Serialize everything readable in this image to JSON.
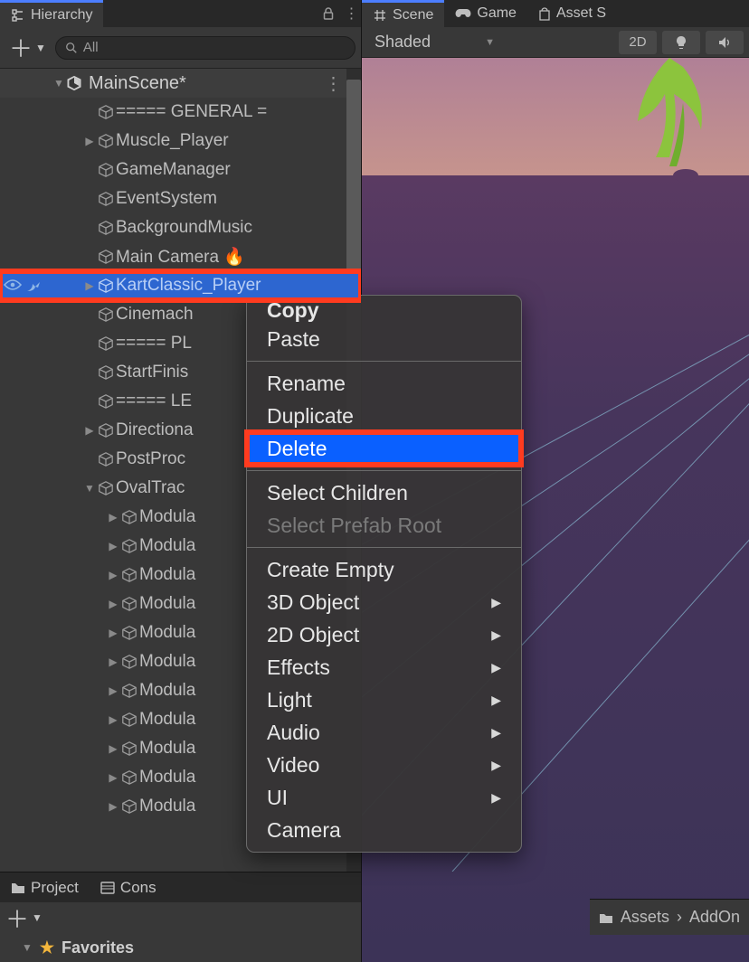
{
  "hierarchy": {
    "tab_label": "Hierarchy",
    "search_text": "All",
    "scene_name": "MainScene*",
    "items": [
      {
        "label": "===== GENERAL =",
        "indent": 2,
        "expand": ""
      },
      {
        "label": "Muscle_Player",
        "indent": 2,
        "expand": "▶"
      },
      {
        "label": "GameManager",
        "indent": 2,
        "expand": ""
      },
      {
        "label": "EventSystem",
        "indent": 2,
        "expand": ""
      },
      {
        "label": "BackgroundMusic",
        "indent": 2,
        "expand": ""
      },
      {
        "label": "Main Camera 🔥",
        "indent": 2,
        "expand": ""
      },
      {
        "label": "KartClassic_Player",
        "indent": 2,
        "expand": "▶",
        "selected": true,
        "highlight_box": true
      },
      {
        "label": "Cinemach",
        "indent": 2,
        "expand": ""
      },
      {
        "label": "===== PL",
        "indent": 2,
        "expand": ""
      },
      {
        "label": "StartFinis",
        "indent": 2,
        "expand": ""
      },
      {
        "label": "===== LE",
        "indent": 2,
        "expand": ""
      },
      {
        "label": "Directiona",
        "indent": 2,
        "expand": "▶"
      },
      {
        "label": "PostProc",
        "indent": 2,
        "expand": ""
      },
      {
        "label": "OvalTrac",
        "indent": 2,
        "expand": "▼"
      },
      {
        "label": "Modula",
        "indent": 3,
        "expand": "▶"
      },
      {
        "label": "Modula",
        "indent": 3,
        "expand": "▶"
      },
      {
        "label": "Modula",
        "indent": 3,
        "expand": "▶"
      },
      {
        "label": "Modula",
        "indent": 3,
        "expand": "▶"
      },
      {
        "label": "Modula",
        "indent": 3,
        "expand": "▶"
      },
      {
        "label": "Modula",
        "indent": 3,
        "expand": "▶"
      },
      {
        "label": "Modula",
        "indent": 3,
        "expand": "▶"
      },
      {
        "label": "Modula",
        "indent": 3,
        "expand": "▶"
      },
      {
        "label": "Modula",
        "indent": 3,
        "expand": "▶"
      },
      {
        "label": "Modula",
        "indent": 3,
        "expand": "▶"
      },
      {
        "label": "Modula",
        "indent": 3,
        "expand": "▶"
      }
    ]
  },
  "bottom_tabs": {
    "project": "Project",
    "console": "Cons"
  },
  "favorites_label": "Favorites",
  "scene_panel": {
    "tabs": [
      {
        "label": "Scene",
        "icon": "grid"
      },
      {
        "label": "Game",
        "icon": "gamepad"
      },
      {
        "label": "Asset S",
        "icon": "bag"
      }
    ],
    "shading": "Shaded",
    "btn_2d": "2D"
  },
  "context_menu": {
    "groups": [
      [
        {
          "label": "Copy",
          "partial_top": true
        },
        {
          "label": "Paste"
        }
      ],
      [
        {
          "label": "Rename"
        },
        {
          "label": "Duplicate"
        },
        {
          "label": "Delete",
          "highlight": true,
          "highlight_box": true
        }
      ],
      [
        {
          "label": "Select Children"
        },
        {
          "label": "Select Prefab Root",
          "disabled": true
        }
      ],
      [
        {
          "label": "Create Empty"
        },
        {
          "label": "3D Object",
          "sub": true
        },
        {
          "label": "2D Object",
          "sub": true
        },
        {
          "label": "Effects",
          "sub": true
        },
        {
          "label": "Light",
          "sub": true
        },
        {
          "label": "Audio",
          "sub": true
        },
        {
          "label": "Video",
          "sub": true
        },
        {
          "label": "UI",
          "sub": true
        },
        {
          "label": "Camera"
        }
      ]
    ]
  },
  "breadcrumb": {
    "root": "Assets",
    "next": "AddOn"
  }
}
